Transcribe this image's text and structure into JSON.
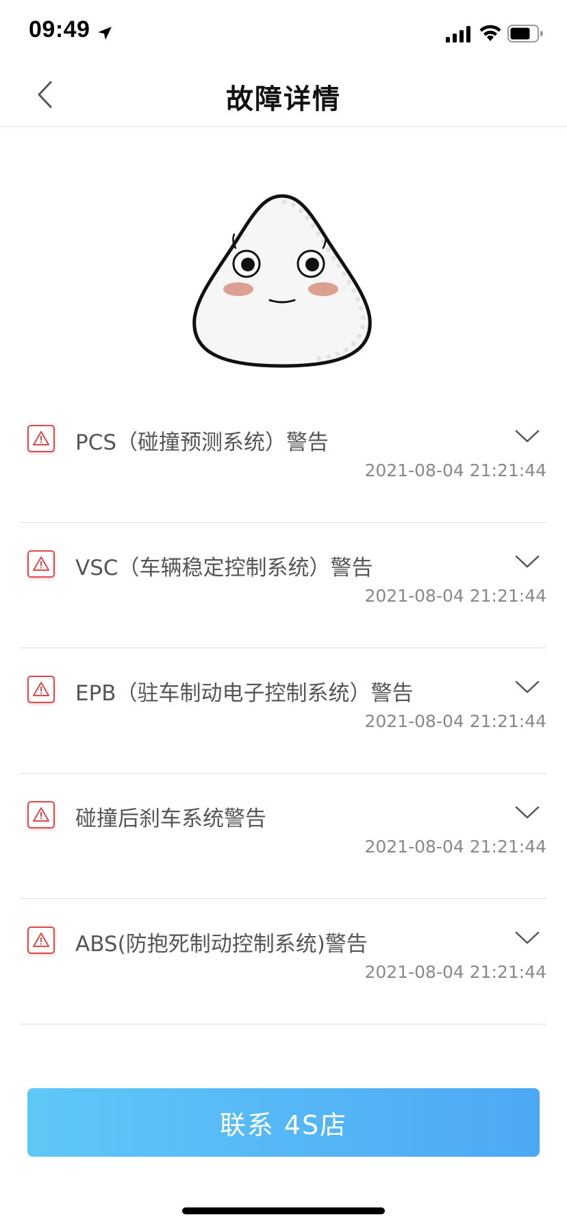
{
  "status_bar": {
    "time": "09:49",
    "icons": [
      "location-arrow-icon",
      "signal-icon",
      "wifi-icon",
      "battery-icon"
    ]
  },
  "nav": {
    "title": "故障详情",
    "back_icon": "chevron-left-icon"
  },
  "mascot": {
    "icon": "rice-ball-mascot"
  },
  "faults": [
    {
      "title": "PCS（碰撞预测系统）警告",
      "time": "2021-08-04 21:21:44",
      "icon": "warning-icon",
      "expand_icon": "chevron-down-icon"
    },
    {
      "title": "VSC（车辆稳定控制系统）警告",
      "time": "2021-08-04 21:21:44",
      "icon": "warning-icon",
      "expand_icon": "chevron-down-icon"
    },
    {
      "title": "EPB（驻车制动电子控制系统）警告",
      "time": "2021-08-04 21:21:44",
      "icon": "warning-icon",
      "expand_icon": "chevron-down-icon"
    },
    {
      "title": "碰撞后刹车系统警告",
      "time": "2021-08-04 21:21:44",
      "icon": "warning-icon",
      "expand_icon": "chevron-down-icon"
    },
    {
      "title": "ABS(防抱死制动控制系统)警告",
      "time": "2021-08-04 21:21:44",
      "icon": "warning-icon",
      "expand_icon": "chevron-down-icon"
    }
  ],
  "contact_button": {
    "label": "联系 4S店"
  },
  "colors": {
    "warning": "#e04848",
    "button_start": "#5ec8f7",
    "button_end": "#4da8f4"
  }
}
